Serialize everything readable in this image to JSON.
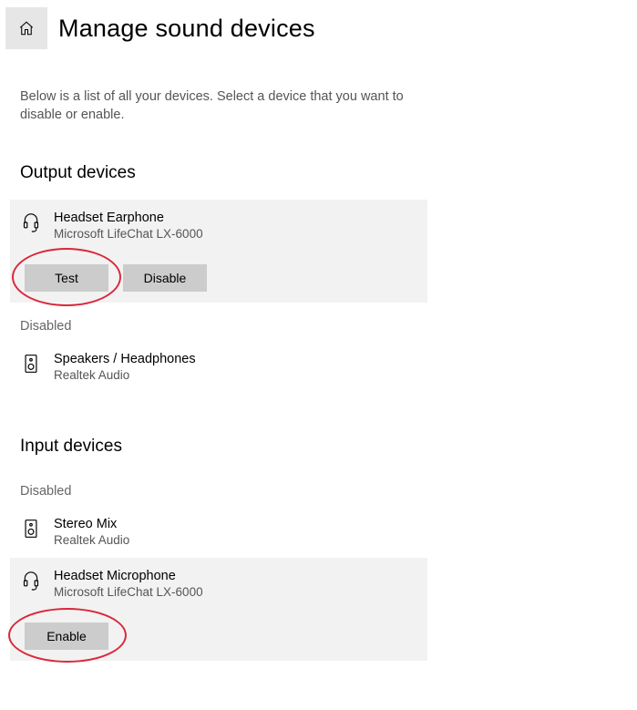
{
  "header": {
    "title": "Manage sound devices"
  },
  "description": "Below is a list of all your devices. Select a device that you want to disable or enable.",
  "sections": {
    "output": {
      "title": "Output devices",
      "devices": {
        "headset": {
          "name": "Headset Earphone",
          "sub": "Microsoft LifeChat LX-6000"
        },
        "speakers": {
          "name": "Speakers / Headphones",
          "sub": "Realtek Audio"
        }
      },
      "disabled_label": "Disabled",
      "buttons": {
        "test": "Test",
        "disable": "Disable"
      }
    },
    "input": {
      "title": "Input devices",
      "disabled_label": "Disabled",
      "devices": {
        "stereomix": {
          "name": "Stereo Mix",
          "sub": "Realtek Audio"
        },
        "headset_mic": {
          "name": "Headset Microphone",
          "sub": "Microsoft LifeChat LX-6000"
        }
      },
      "buttons": {
        "enable": "Enable"
      }
    }
  }
}
